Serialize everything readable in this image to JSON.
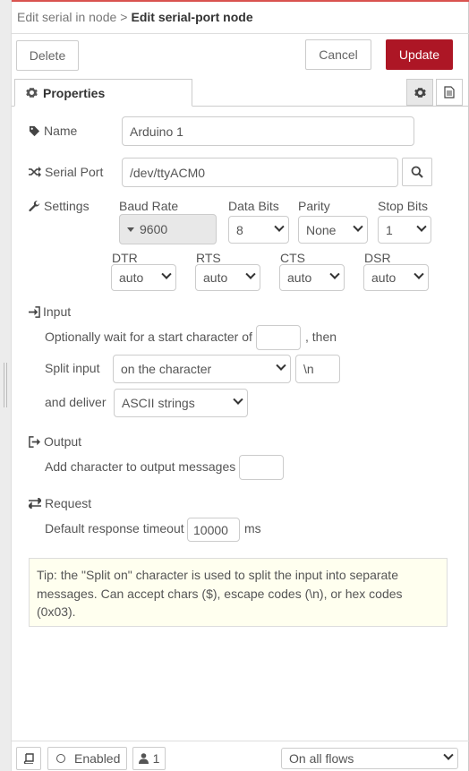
{
  "header": {
    "breadcrumb_parent": "Edit serial in node",
    "breadcrumb_separator": ">",
    "title": "Edit serial-port node"
  },
  "toolbar": {
    "delete_label": "Delete",
    "cancel_label": "Cancel",
    "update_label": "Update"
  },
  "colors": {
    "primary": "#ad1625",
    "tip_background": "#ffffef",
    "top_accent": "#d9534f"
  },
  "tabs": {
    "properties_label": "Properties",
    "icons": [
      "gear-icon",
      "document-icon"
    ]
  },
  "form": {
    "name_label": "Name",
    "name_value": "Arduino 1",
    "serial_port_label": "Serial Port",
    "serial_port_value": "/dev/ttyACM0",
    "settings_label": "Settings",
    "baud_rate_label": "Baud Rate",
    "baud_rate_value": "9600",
    "data_bits_label": "Data Bits",
    "data_bits_value": "8",
    "parity_label": "Parity",
    "parity_value": "None",
    "stop_bits_label": "Stop Bits",
    "stop_bits_value": "1",
    "dtr_label": "DTR",
    "dtr_value": "auto",
    "rts_label": "RTS",
    "rts_value": "auto",
    "cts_label": "CTS",
    "cts_value": "auto",
    "dsr_label": "DSR",
    "dsr_value": "auto"
  },
  "input_section": {
    "label": "Input",
    "start_char_prefix": "Optionally wait for a start character of",
    "start_char_value": "",
    "start_char_suffix": ", then",
    "split_label": "Split input",
    "split_value": "on the character",
    "split_char_value": "\\n",
    "deliver_label": "and deliver",
    "deliver_value": "ASCII strings"
  },
  "output_section": {
    "label": "Output",
    "add_char_label": "Add character to output messages",
    "add_char_value": ""
  },
  "request_section": {
    "label": "Request",
    "timeout_label": "Default response timeout",
    "timeout_value": "10000",
    "timeout_unit": "ms"
  },
  "tip": {
    "text": "Tip: the \"Split on\" character is used to split the input into separate messages. Can accept chars ($), escape codes (\\n), or hex codes (0x03)."
  },
  "footer": {
    "enabled_label": "Enabled",
    "users_count": "1",
    "flows_value": "On all flows"
  }
}
